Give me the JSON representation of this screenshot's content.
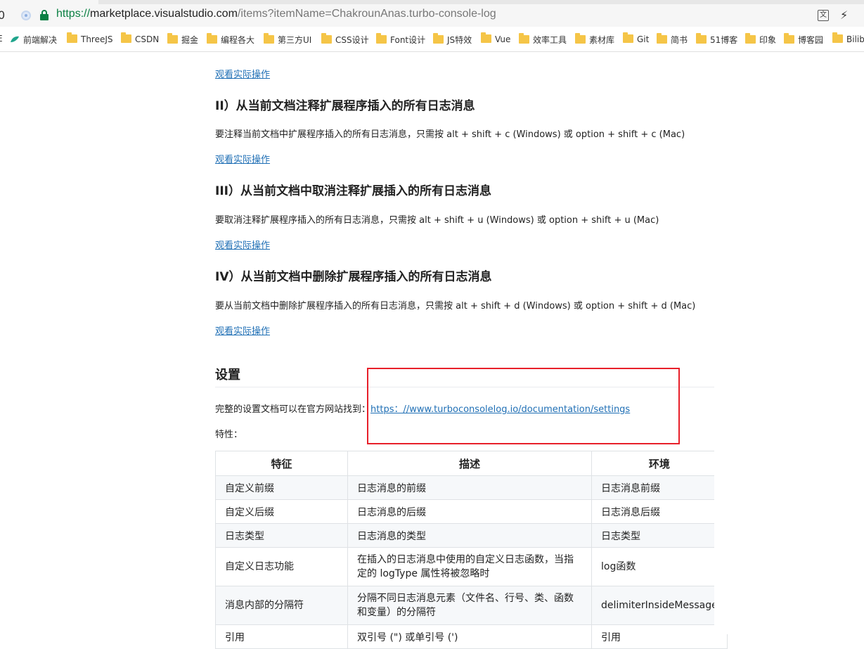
{
  "browser": {
    "edge_char": "0",
    "url_scheme": "https://",
    "url_host": "marketplace.visualstudio.com",
    "url_path": "/items?itemName=ChakrounAnas.turbo-console-log",
    "translate_icon": "translate-icon",
    "translate_glyph": "文",
    "bolt_glyph": "⚡"
  },
  "bookmarks": {
    "first_char": "E",
    "items": [
      {
        "label": "前端解决",
        "icon": "leaf"
      },
      {
        "label": "ThreeJS",
        "icon": "folder"
      },
      {
        "label": "CSDN",
        "icon": "folder"
      },
      {
        "label": "掘金",
        "icon": "folder"
      },
      {
        "label": "编程各大",
        "icon": "folder"
      },
      {
        "label": "第三方UI",
        "icon": "folder"
      },
      {
        "label": "CSS设计",
        "icon": "folder"
      },
      {
        "label": "Font设计",
        "icon": "folder"
      },
      {
        "label": "JS特效",
        "icon": "folder"
      },
      {
        "label": "Vue",
        "icon": "folder"
      },
      {
        "label": "效率工具",
        "icon": "folder"
      },
      {
        "label": "素材库",
        "icon": "folder"
      },
      {
        "label": "Git",
        "icon": "folder"
      },
      {
        "label": "简书",
        "icon": "folder"
      },
      {
        "label": "51博客",
        "icon": "folder"
      },
      {
        "label": "印象",
        "icon": "folder"
      },
      {
        "label": "博客园",
        "icon": "folder"
      },
      {
        "label": "Bilibi",
        "icon": "folder"
      }
    ]
  },
  "doc": {
    "watch_link": "观看实际操作",
    "sec2_title": "II）从当前文档注释扩展程序插入的所有日志消息",
    "sec2_text": "要注释当前文档中扩展程序插入的所有日志消息，只需按 alt + shift + c (Windows) 或 option + shift + c (Mac)",
    "sec3_title": "III）从当前文档中取消注释扩展插入的所有日志消息",
    "sec3_text": "要取消注释扩展程序插入的所有日志消息，只需按 alt + shift + u (Windows) 或 option + shift + u (Mac)",
    "sec4_title": "IV）从当前文档中删除扩展程序插入的所有日志消息",
    "sec4_text": "要从当前文档中删除扩展程序插入的所有日志消息，只需按 alt + shift + d (Windows) 或 option + shift + d (Mac)",
    "settings_title": "设置",
    "settings_intro": "完整的设置文档可以在官方网站找到：",
    "settings_url": "https：//www.turboconsolelog.io/documentation/settings",
    "features_label": "特性："
  },
  "table": {
    "headers": [
      "特征",
      "描述",
      "环境"
    ],
    "rows": [
      [
        "自定义前缀",
        "日志消息的前缀",
        "日志消息前缀"
      ],
      [
        "自定义后缀",
        "日志消息的后缀",
        "日志消息后缀"
      ],
      [
        "日志类型",
        "日志消息的类型",
        "日志类型"
      ],
      [
        "自定义日志功能",
        "在插入的日志消息中使用的自定义日志函数，当指定的 logType 属性将被忽略时",
        "log函数"
      ],
      [
        "消息内部的分隔符",
        "分隔不同日志消息元素（文件名、行号、类、函数和变量）的分隔符",
        "delimiterInsideMessage"
      ],
      [
        "引用",
        "双引号 (\") 或单引号 (')",
        "引用"
      ]
    ]
  },
  "colors": {
    "link": "#1f6fb5",
    "highlight_box": "#e8202a",
    "url_scheme": "#0b8043"
  }
}
